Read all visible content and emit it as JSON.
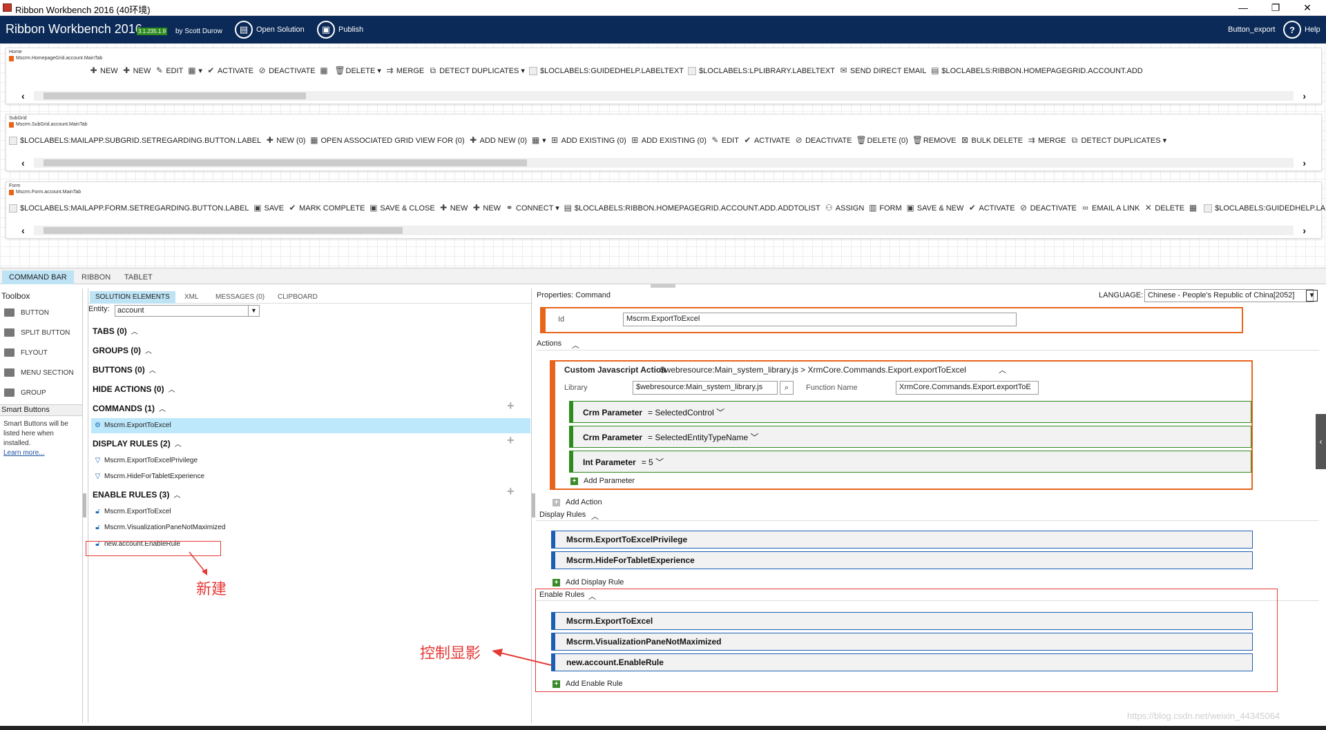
{
  "window": {
    "title": "Ribbon Workbench 2016 (40环境)",
    "minimize": "—",
    "restore": "❐",
    "close": "✕"
  },
  "header": {
    "app_name": "Ribbon Workbench 2016",
    "version": "3.1.235.1.9",
    "by": "by Scott Durow",
    "open_solution": "Open Solution",
    "publish": "Publish",
    "solution_name": "Button_export",
    "help": "Help"
  },
  "ribbons": [
    {
      "row_name": "Home",
      "tab_name": "Mscrm.HomepageGrid.account.MainTab",
      "commands": [
        {
          "icon": "plus-icon",
          "label": "NEW"
        },
        {
          "icon": "plus-icon",
          "label": "NEW"
        },
        {
          "icon": "edit-icon",
          "label": "EDIT"
        },
        {
          "icon": "grid-icon",
          "label": "▾"
        },
        {
          "icon": "check-icon",
          "label": "ACTIVATE"
        },
        {
          "icon": "deactivate-icon",
          "label": "DEACTIVATE"
        },
        {
          "icon": "grid-icon",
          "label": ""
        },
        {
          "icon": "trash-icon",
          "label": "DELETE ▾"
        },
        {
          "icon": "merge-icon",
          "label": "MERGE"
        },
        {
          "icon": "duplicate-icon",
          "label": "DETECT DUPLICATES ▾"
        },
        {
          "icon": "checkbox-icon",
          "label": "$LOCLABELS:GUIDEDHELP.LABELTEXT"
        },
        {
          "icon": "checkbox-icon",
          "label": "$LOCLABELS:LPLIBRARY.LABELTEXT"
        },
        {
          "icon": "mail-icon",
          "label": "SEND DIRECT EMAIL"
        },
        {
          "icon": "addlist-icon",
          "label": "$LOCLABELS:RIBBON.HOMEPAGEGRID.ACCOUNT.ADD"
        }
      ]
    },
    {
      "row_name": "SubGrid",
      "tab_name": "Mscrm.SubGrid.account.MainTab",
      "commands": [
        {
          "icon": "checkbox-icon",
          "label": "$LOCLABELS:MAILAPP.SUBGRID.SETREGARDING.BUTTON.LABEL"
        },
        {
          "icon": "plus-icon",
          "label": "NEW (0)"
        },
        {
          "icon": "grid-icon",
          "label": "OPEN ASSOCIATED GRID VIEW FOR (0)"
        },
        {
          "icon": "plus-icon",
          "label": "ADD NEW (0)"
        },
        {
          "icon": "grid-icon",
          "label": "▾"
        },
        {
          "icon": "addexisting-icon",
          "label": "ADD EXISTING (0)"
        },
        {
          "icon": "addexisting-icon",
          "label": "ADD EXISTING (0)"
        },
        {
          "icon": "edit-icon",
          "label": "EDIT"
        },
        {
          "icon": "check-icon",
          "label": "ACTIVATE"
        },
        {
          "icon": "deactivate-icon",
          "label": "DEACTIVATE"
        },
        {
          "icon": "trash-icon",
          "label": "DELETE (0)"
        },
        {
          "icon": "trash-icon",
          "label": "REMOVE"
        },
        {
          "icon": "bulkdelete-icon",
          "label": "BULK DELETE"
        },
        {
          "icon": "merge-icon",
          "label": "MERGE"
        },
        {
          "icon": "duplicate-icon",
          "label": "DETECT DUPLICATES ▾"
        }
      ]
    },
    {
      "row_name": "Form",
      "tab_name": "Mscrm.Form.account.MainTab",
      "commands": [
        {
          "icon": "checkbox-icon",
          "label": "$LOCLABELS:MAILAPP.FORM.SETREGARDING.BUTTON.LABEL"
        },
        {
          "icon": "save-icon",
          "label": "SAVE"
        },
        {
          "icon": "check-icon",
          "label": "MARK COMPLETE"
        },
        {
          "icon": "saveclose-icon",
          "label": "SAVE & CLOSE"
        },
        {
          "icon": "plus-icon",
          "label": "NEW"
        },
        {
          "icon": "plus-icon",
          "label": "NEW"
        },
        {
          "icon": "connect-icon",
          "label": "CONNECT ▾"
        },
        {
          "icon": "addlist-icon",
          "label": "$LOCLABELS:RIBBON.HOMEPAGEGRID.ACCOUNT.ADD.ADDTOLIST"
        },
        {
          "icon": "assign-icon",
          "label": "ASSIGN"
        },
        {
          "icon": "form-icon",
          "label": "FORM"
        },
        {
          "icon": "save-icon",
          "label": "SAVE & NEW"
        },
        {
          "icon": "check-icon",
          "label": "ACTIVATE"
        },
        {
          "icon": "deactivate-icon",
          "label": "DEACTIVATE"
        },
        {
          "icon": "link-icon",
          "label": "EMAIL A LINK"
        },
        {
          "icon": "x-icon",
          "label": "DELETE"
        },
        {
          "icon": "grid-icon",
          "label": ""
        },
        {
          "icon": "checkbox-icon",
          "label": "$LOCLABELS:GUIDEDHELP.LABE"
        }
      ]
    }
  ],
  "main_tabs": [
    "COMMAND BAR",
    "RIBBON",
    "TABLET"
  ],
  "toolbox": {
    "title": "Toolbox",
    "items": [
      "BUTTON",
      "SPLIT BUTTON",
      "FLYOUT",
      "MENU SECTION",
      "GROUP"
    ],
    "smart_title": "Smart Buttons",
    "smart_text": "Smart Buttons will be listed here when installed.",
    "learn_more": "Learn more..."
  },
  "solution": {
    "tabs": [
      "SOLUTION ELEMENTS",
      "XML",
      "MESSAGES (0)",
      "CLIPBOARD"
    ],
    "entity_label": "Entity:",
    "entity_value": "account",
    "sections": {
      "tabs": "TABS (0)",
      "groups": "GROUPS (0)",
      "buttons": "BUTTONS (0)",
      "hide_actions": "HIDE ACTIONS (0)",
      "commands": "COMMANDS (1)",
      "display_rules": "DISPLAY RULES (2)",
      "enable_rules": "ENABLE RULES (3)"
    },
    "commands": [
      "Mscrm.ExportToExcel"
    ],
    "display_rules": [
      "Mscrm.ExportToExcelPrivilege",
      "Mscrm.HideForTabletExperience"
    ],
    "enable_rules": [
      "Mscrm.ExportToExcel",
      "Mscrm.VisualizationPaneNotMaximized",
      "new.account.EnableRule"
    ],
    "annotation_new": "新建"
  },
  "properties": {
    "title": "Properties: Command",
    "language_label": "LANGUAGE:",
    "language_value": "Chinese - People's Republic of China[2052]",
    "id_label": "Id",
    "id_value": "Mscrm.ExportToExcel",
    "actions_title": "Actions",
    "action": {
      "type": "Custom Javascript Action",
      "summary": "$webresource:Main_system_library.js > XrmCore.Commands.Export.exportToExcel",
      "library_label": "Library",
      "library_value": "$webresource:Main_system_library.js",
      "function_label": "Function Name",
      "function_value": "XrmCore.Commands.Export.exportToE",
      "params": [
        {
          "type": "Crm Parameter",
          "value": "= SelectedControl"
        },
        {
          "type": "Crm Parameter",
          "value": "= SelectedEntityTypeName"
        },
        {
          "type": "Int Parameter",
          "value": "= 5"
        }
      ],
      "add_parameter": "Add Parameter"
    },
    "add_action": "Add Action",
    "display_rules_title": "Display Rules",
    "display_rules": [
      "Mscrm.ExportToExcelPrivilege",
      "Mscrm.HideForTabletExperience"
    ],
    "add_display_rule": "Add Display Rule",
    "enable_rules_title": "Enable Rules",
    "enable_rules": [
      "Mscrm.ExportToExcel",
      "Mscrm.VisualizationPaneNotMaximized",
      "new.account.EnableRule"
    ],
    "add_enable_rule": "Add Enable Rule",
    "annotation_control": "控制显影"
  },
  "watermark": "https://blog.csdn.net/weixin_44345064",
  "colors": {
    "header_bg": "#0b2a57",
    "accent_orange": "#e8641b",
    "rule_blue": "#1a5fb4",
    "param_green": "#2e8b1e",
    "annotation_red": "#e53935"
  }
}
